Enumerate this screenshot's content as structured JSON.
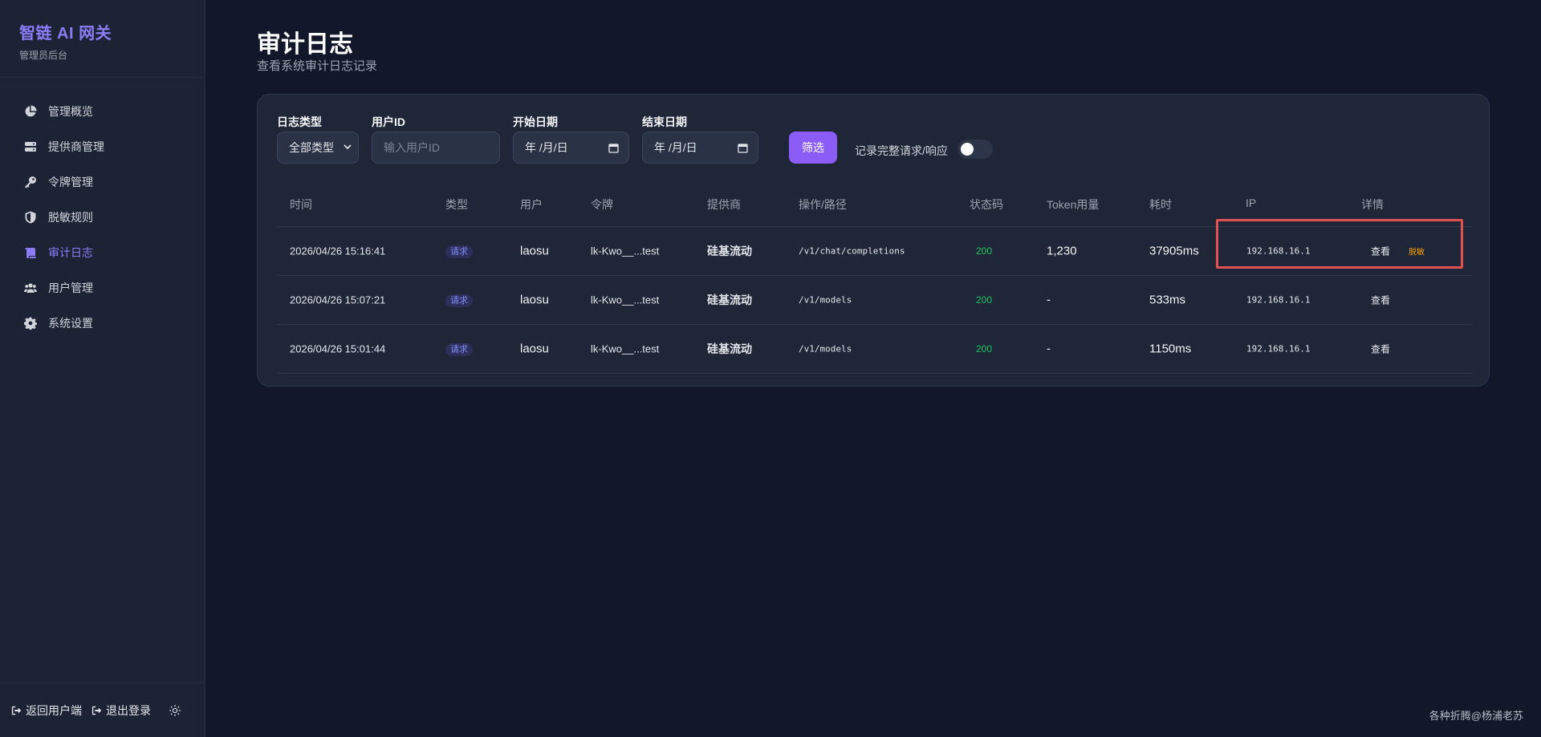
{
  "brand": {
    "title": "智链 AI 网关",
    "subtitle": "管理员后台"
  },
  "nav": {
    "items": [
      {
        "label": "管理概览",
        "icon": "pie-chart-icon"
      },
      {
        "label": "提供商管理",
        "icon": "server-icon"
      },
      {
        "label": "令牌管理",
        "icon": "key-icon"
      },
      {
        "label": "脱敏规则",
        "icon": "shield-icon"
      },
      {
        "label": "审计日志",
        "icon": "scroll-icon",
        "active": true
      },
      {
        "label": "用户管理",
        "icon": "users-icon"
      },
      {
        "label": "系统设置",
        "icon": "gear-icon"
      }
    ]
  },
  "footer": {
    "back_label": "返回用户端",
    "logout_label": "退出登录"
  },
  "page": {
    "title": "审计日志",
    "subtitle": "查看系统审计日志记录"
  },
  "filters": {
    "log_type_label": "日志类型",
    "log_type_value": "全部类型",
    "user_id_label": "用户ID",
    "user_id_placeholder": "输入用户ID",
    "start_date_label": "开始日期",
    "start_date_value": "年 /月/日",
    "end_date_label": "结束日期",
    "end_date_value": "年 /月/日",
    "filter_button": "筛选",
    "toggle_label": "记录完整请求/响应",
    "toggle_on": false
  },
  "table": {
    "headers": [
      "时间",
      "类型",
      "用户",
      "令牌",
      "提供商",
      "操作/路径",
      "状态码",
      "Token用量",
      "耗时",
      "IP",
      "详情"
    ],
    "rows": [
      {
        "time": "2026/04/26 15:16:41",
        "type": "请求",
        "user": "laosu",
        "token": "lk-Kwo__...test",
        "provider": "硅基流动",
        "path": "/v1/chat/completions",
        "status": "200",
        "tokens": "1,230",
        "duration": "37905ms",
        "ip": "192.168.16.1",
        "view": "查看",
        "mask": "脱敏"
      },
      {
        "time": "2026/04/26 15:07:21",
        "type": "请求",
        "user": "laosu",
        "token": "lk-Kwo__...test",
        "provider": "硅基流动",
        "path": "/v1/models",
        "status": "200",
        "tokens": "-",
        "duration": "533ms",
        "ip": "192.168.16.1",
        "view": "查看"
      },
      {
        "time": "2026/04/26 15:01:44",
        "type": "请求",
        "user": "laosu",
        "token": "lk-Kwo__...test",
        "provider": "硅基流动",
        "path": "/v1/models",
        "status": "200",
        "tokens": "-",
        "duration": "1150ms",
        "ip": "192.168.16.1",
        "view": "查看"
      }
    ]
  },
  "watermark": "各种折腾@杨浦老苏",
  "colors": {
    "accent": "#8b5cf6",
    "brand": "#8b7cf6",
    "status_ok": "#22c55e",
    "mask": "#f59e0b",
    "highlight": "#e05252"
  }
}
